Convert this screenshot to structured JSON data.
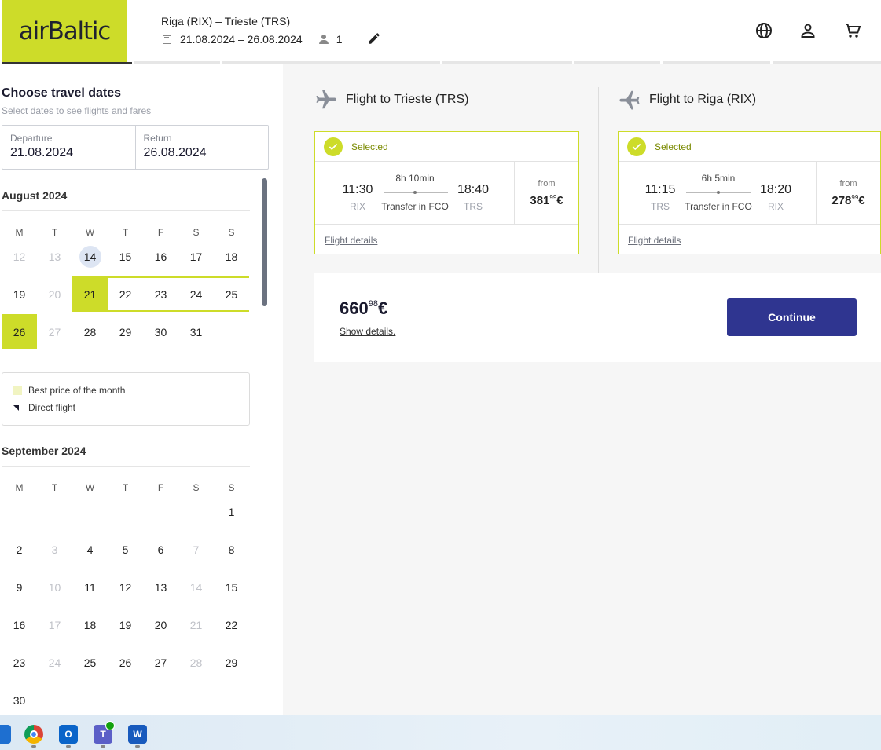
{
  "brand": {
    "logo_text": "airBaltic",
    "accent": "#cddc29",
    "primary": "#2f3590"
  },
  "header": {
    "route": "Riga (RIX) – Trieste (TRS)",
    "dates": "21.08.2024 – 26.08.2024",
    "passengers": "1",
    "icons": [
      "calendar-icon",
      "passenger-icon",
      "edit-icon",
      "globe-icon",
      "user-icon",
      "cart-icon"
    ]
  },
  "sidebar": {
    "title": "Choose travel dates",
    "subtitle": "Select dates to see flights and fares",
    "departure": {
      "label": "Departure",
      "value": "21.08.2024"
    },
    "return": {
      "label": "Return",
      "value": "26.08.2024"
    },
    "weekdays": [
      "M",
      "T",
      "W",
      "T",
      "F",
      "S",
      "S"
    ],
    "august": {
      "title": "August 2024",
      "weeks": [
        [
          "12",
          "13",
          "14",
          "15",
          "16",
          "17",
          "18"
        ],
        [
          "19",
          "20",
          "21",
          "22",
          "23",
          "24",
          "25"
        ],
        [
          "26",
          "27",
          "28",
          "29",
          "30",
          "31",
          ""
        ]
      ]
    },
    "legend": {
      "best_price": "Best price of the month",
      "direct": "Direct flight"
    },
    "september": {
      "title": "September 2024",
      "weeks": [
        [
          "",
          "",
          "",
          "",
          "",
          "",
          "1"
        ],
        [
          "2",
          "3",
          "4",
          "5",
          "6",
          "7",
          "8"
        ],
        [
          "9",
          "10",
          "11",
          "12",
          "13",
          "14",
          "15"
        ],
        [
          "16",
          "17",
          "18",
          "19",
          "20",
          "21",
          "22"
        ],
        [
          "23",
          "24",
          "25",
          "26",
          "27",
          "28",
          "29"
        ],
        [
          "30",
          "",
          "",
          "",
          "",
          "",
          ""
        ]
      ]
    }
  },
  "outbound": {
    "title": "Flight to Trieste (TRS)",
    "status": "Selected",
    "dep_time": "11:30",
    "dep_airport": "RIX",
    "arr_time": "18:40",
    "arr_airport": "TRS",
    "duration": "8h 10min",
    "transfer": "Transfer in FCO",
    "from_label": "from",
    "price_main": "381",
    "price_cents": "99",
    "currency": "€",
    "details": "Flight details"
  },
  "inbound": {
    "title": "Flight to Riga (RIX)",
    "status": "Selected",
    "dep_time": "11:15",
    "dep_airport": "TRS",
    "arr_time": "18:20",
    "arr_airport": "RIX",
    "duration": "6h 5min",
    "transfer": "Transfer in FCO",
    "from_label": "from",
    "price_main": "278",
    "price_cents": "99",
    "currency": "€",
    "details": "Flight details"
  },
  "summary": {
    "total_main": "660",
    "total_cents": "98",
    "currency": "€",
    "show_details": "Show details.",
    "continue": "Continue"
  },
  "taskbar": {
    "apps": [
      "mail-app-icon",
      "chrome-icon",
      "outlook-icon",
      "teams-icon",
      "word-icon"
    ]
  }
}
